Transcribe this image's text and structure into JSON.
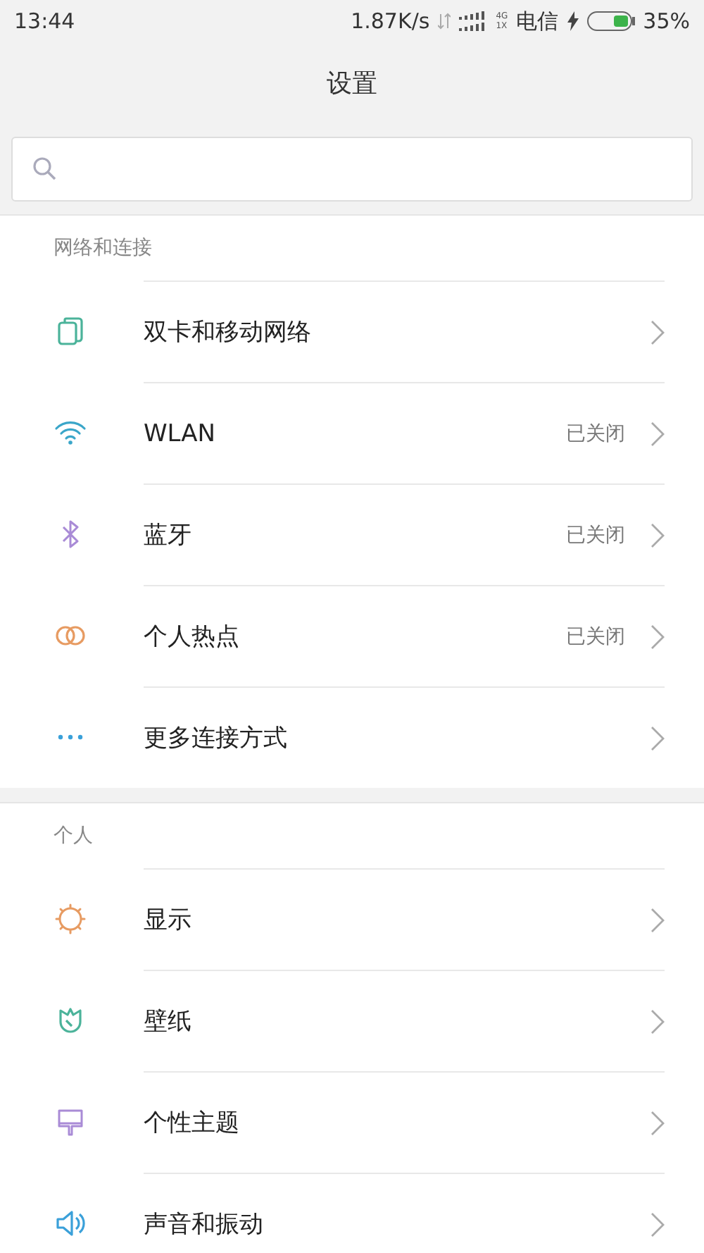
{
  "status_bar": {
    "time": "13:44",
    "speed": "1.87K/s",
    "network_top": "4G",
    "network_bottom": "1X",
    "carrier": "电信",
    "battery": "35%"
  },
  "title": "设置",
  "sections": [
    {
      "header": "网络和连接",
      "items": [
        {
          "kind": "sim",
          "label": "双卡和移动网络"
        },
        {
          "kind": "wifi",
          "label": "WLAN",
          "value": "已关闭"
        },
        {
          "kind": "bluetooth",
          "label": "蓝牙",
          "value": "已关闭"
        },
        {
          "kind": "hotspot",
          "label": "个人热点",
          "value": "已关闭"
        },
        {
          "kind": "more",
          "label": "更多连接方式"
        }
      ]
    },
    {
      "header": "个人",
      "items": [
        {
          "kind": "display",
          "label": "显示"
        },
        {
          "kind": "wallpaper",
          "label": "壁纸"
        },
        {
          "kind": "theme",
          "label": "个性主题"
        },
        {
          "kind": "sound",
          "label": "声音和振动"
        }
      ]
    }
  ]
}
